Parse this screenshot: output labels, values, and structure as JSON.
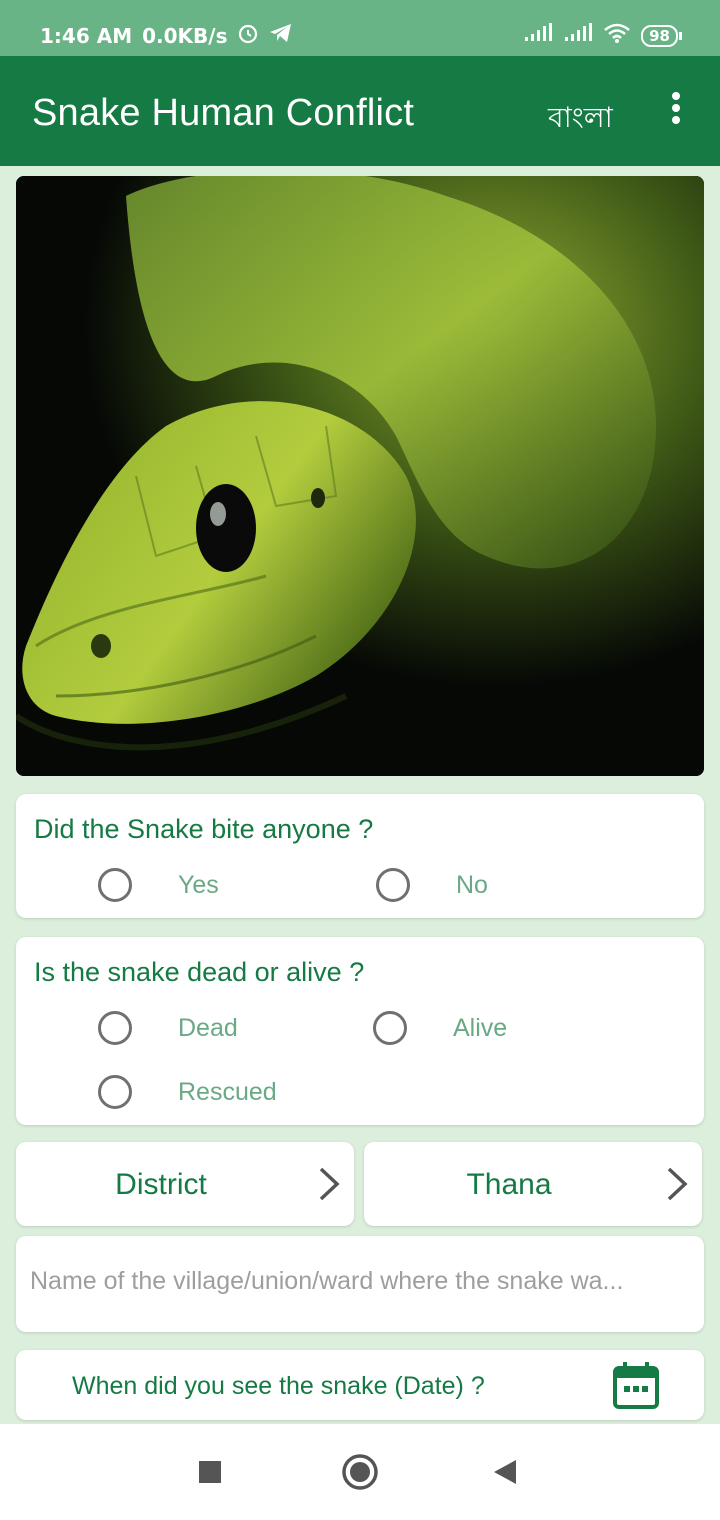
{
  "status_bar": {
    "time": "1:46 AM",
    "net_speed": "0.0KB/s",
    "battery": "98",
    "icons": [
      "alarm-icon",
      "telegram-icon",
      "signal-icon",
      "signal-icon",
      "wifi-icon",
      "battery-icon"
    ]
  },
  "app_bar": {
    "title": "Snake Human Conflict",
    "language_button": "বাংলা",
    "menu_icon": "overflow-menu-icon"
  },
  "colors": {
    "primary": "#157a43",
    "status_bar": "#68b487",
    "background": "#dcefdc",
    "option_text": "#6aa985"
  },
  "question_bite": {
    "title": "Did the Snake bite anyone ?",
    "options": [
      "Yes",
      "No"
    ]
  },
  "question_state": {
    "title": "Is the snake dead or alive ?",
    "options": [
      "Dead",
      "Alive",
      "Rescued"
    ]
  },
  "location": {
    "district_label": "District",
    "thana_label": "Thana"
  },
  "village_input": {
    "placeholder": "Name of the village/union/ward where the snake wa...",
    "value": ""
  },
  "date_field": {
    "label": "When did you see the snake (Date) ?",
    "icon": "calendar-icon"
  },
  "nav": {
    "icons": [
      "recents-square-icon",
      "home-circle-icon",
      "back-triangle-icon"
    ]
  }
}
